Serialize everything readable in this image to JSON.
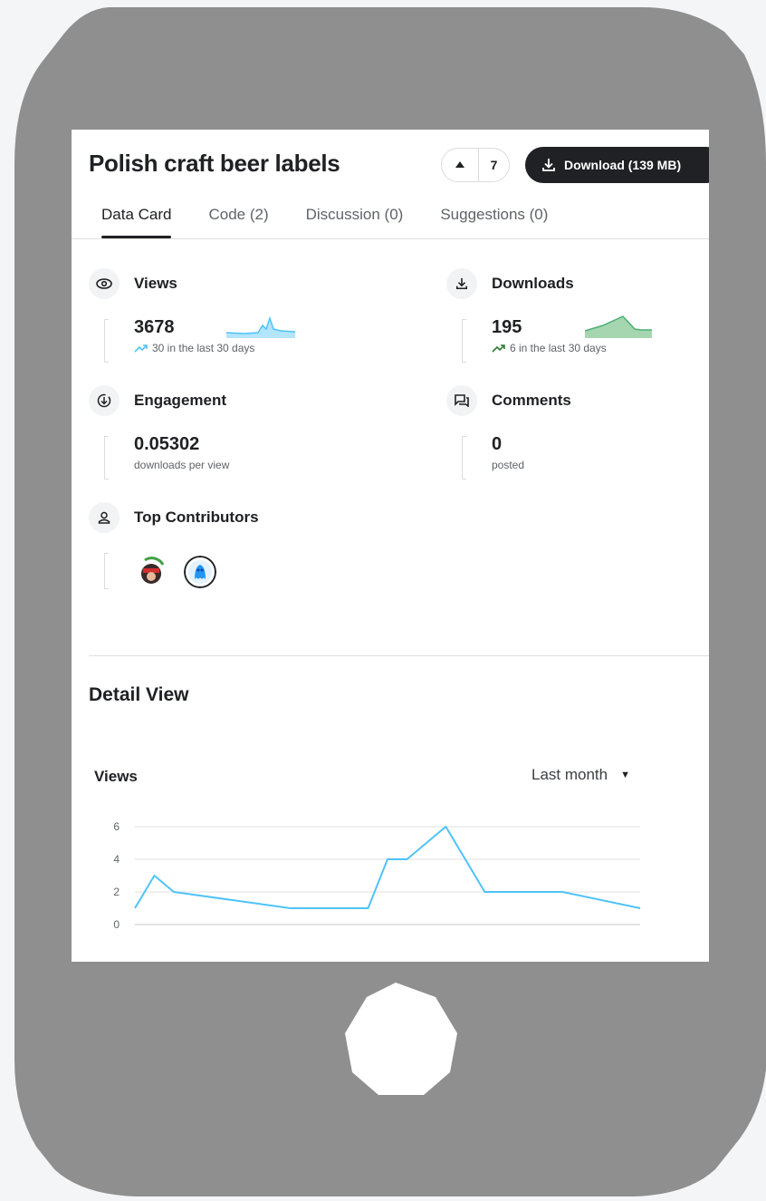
{
  "dataset": {
    "title": "Polish craft beer labels",
    "upvotes": "7",
    "download_label": "Download (139 MB)"
  },
  "tabs": [
    {
      "label": "Data Card",
      "active": true
    },
    {
      "label": "Code (2)",
      "active": false
    },
    {
      "label": "Discussion (0)",
      "active": false
    },
    {
      "label": "Suggestions (0)",
      "active": false
    }
  ],
  "stats": {
    "views": {
      "label": "Views",
      "value": "3678",
      "sub": "30 in the last 30 days",
      "icon": "eye-icon"
    },
    "downloads": {
      "label": "Downloads",
      "value": "195",
      "sub": "6 in the last 30 days",
      "icon": "download-icon"
    },
    "engagement": {
      "label": "Engagement",
      "value": "0.05302",
      "sub": "downloads per view",
      "icon": "engagement-icon"
    },
    "comments": {
      "label": "Comments",
      "value": "0",
      "sub": "posted",
      "icon": "comments-icon"
    },
    "contributors": {
      "label": "Top Contributors",
      "icon": "person-icon"
    }
  },
  "detail": {
    "title": "Detail View",
    "chart_title": "Views",
    "range": "Last month"
  },
  "colors": {
    "line": "#4fc3f7",
    "views_spark": "#4fc3f7",
    "downloads_spark": "#4caf72",
    "button": "#202124",
    "frame": "#8f8f8f"
  },
  "chart_data": {
    "type": "line",
    "title": "Views",
    "y_ticks": [
      0,
      2,
      4,
      6
    ],
    "ylim": [
      0,
      6
    ],
    "values": [
      1,
      3,
      2,
      1,
      1,
      4,
      4,
      6,
      2,
      2,
      1
    ],
    "x_index": [
      0,
      1,
      2,
      8,
      12,
      13,
      14,
      16,
      18,
      22,
      26
    ],
    "x_count": 26
  }
}
